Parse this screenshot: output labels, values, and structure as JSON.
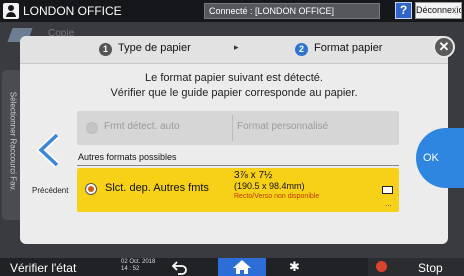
{
  "topbar": {
    "title": "LONDON OFFICE",
    "connection": "Connecté : [LONDON OFFICE]",
    "help_label": "?",
    "logout_label": "Déconnexion"
  },
  "background_app": {
    "copy_label": "Copie",
    "side_tab_label": "Sélectionner Raccourci Fav."
  },
  "wizard": {
    "steps": [
      {
        "number": "1",
        "label": "Type de papier",
        "state": "done"
      },
      {
        "number": "2",
        "label": "Format papier",
        "state": "active"
      }
    ],
    "step_separator": "▸",
    "close_label": "✕",
    "message_line1": "Le format papier suivant est détecté.",
    "message_line2": "Vérifier que le guide papier corresponde au papier.",
    "auto_detect_label": "Frmt détect. auto",
    "custom_size_label": "Format personnalisé",
    "other_formats_label": "Autres formats possibles",
    "selected_option": {
      "label": "Slct. dep. Autres fmts",
      "size": "3⅞ x 7½",
      "size_mm": "(190.5 x 98.4mm)",
      "note": "Recto/Verso non disponible",
      "more": "..."
    },
    "previous_label": "Précédent",
    "ok_label": "OK"
  },
  "bottombar": {
    "check_status_label": "Vérifier l'état",
    "date": "02 Oct. 2018",
    "time": "14 : 52",
    "stop_label": "Stop"
  },
  "colors": {
    "accent_blue": "#2f86e0",
    "selected_row": "#f7d117",
    "home_blue": "#2b6ed6"
  }
}
